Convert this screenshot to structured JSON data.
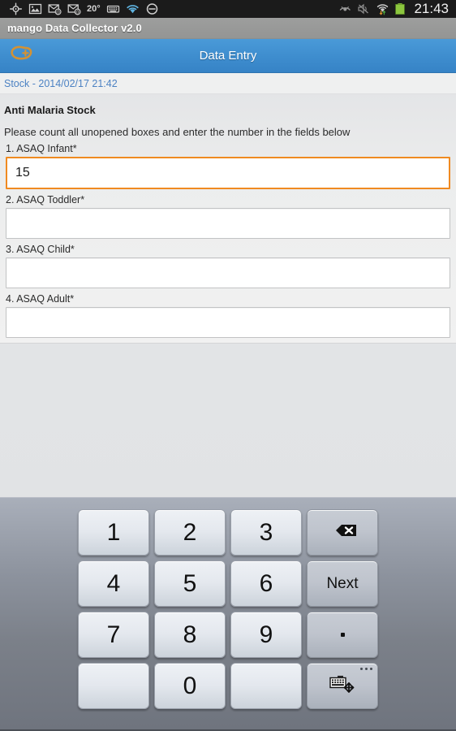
{
  "status_bar": {
    "left_icons": [
      {
        "name": "gps-location-icon",
        "glyph": "gps"
      },
      {
        "name": "image-gallery-icon",
        "glyph": "image"
      },
      {
        "name": "email-at-icon-1",
        "glyph": "email"
      },
      {
        "name": "email-at-icon-2",
        "glyph": "email"
      },
      {
        "name": "keyboard-icon",
        "glyph": "keyboard"
      },
      {
        "name": "wifi-icon",
        "glyph": "wifi"
      },
      {
        "name": "do-not-disturb-icon",
        "glyph": "dnd"
      }
    ],
    "temperature": "20°",
    "right_icons": [
      {
        "name": "smart-stay-eye-icon",
        "glyph": "eye"
      },
      {
        "name": "sound-muted-icon",
        "glyph": "mute"
      },
      {
        "name": "wifi-transfer-icon",
        "glyph": "wifi-arrows"
      },
      {
        "name": "battery-icon",
        "glyph": "battery"
      }
    ],
    "clock": "21:43",
    "battery_color": "#8cc63e"
  },
  "app_bar": {
    "title": "mango Data Collector v2.0"
  },
  "action_bar": {
    "logo_name": "mango-logo-icon",
    "logo_color": "#d49233",
    "title": "Data Entry",
    "accent_color": "#3f8ecf"
  },
  "breadcrumb": {
    "text": "Stock - 2014/02/17 21:42",
    "link_color": "#4c82c3"
  },
  "form": {
    "group_title": "Anti Malaria Stock",
    "group_description": "Please count all unopened boxes and enter the number in the fields below",
    "focus_color": "#f08a21",
    "fields": [
      {
        "label": "1. ASAQ Infant*",
        "value": "15",
        "placeholder": "",
        "focused": true
      },
      {
        "label": "2. ASAQ Toddler*",
        "value": "",
        "placeholder": "",
        "focused": false
      },
      {
        "label": "3. ASAQ Child*",
        "value": "",
        "placeholder": "",
        "focused": false
      },
      {
        "label": "4. ASAQ Adult*",
        "value": "",
        "placeholder": "",
        "focused": false
      }
    ]
  },
  "keyboard": {
    "rows": [
      [
        {
          "label": "1",
          "type": "num",
          "name": "key-1"
        },
        {
          "label": "2",
          "type": "num",
          "name": "key-2"
        },
        {
          "label": "3",
          "type": "num",
          "name": "key-3"
        },
        {
          "label": "",
          "type": "icon",
          "icon": "backspace-icon",
          "name": "key-backspace"
        }
      ],
      [
        {
          "label": "4",
          "type": "num",
          "name": "key-4"
        },
        {
          "label": "5",
          "type": "num",
          "name": "key-5"
        },
        {
          "label": "6",
          "type": "num",
          "name": "key-6"
        },
        {
          "label": "Next",
          "type": "fn",
          "name": "key-next"
        }
      ],
      [
        {
          "label": "7",
          "type": "num",
          "name": "key-7"
        },
        {
          "label": "8",
          "type": "num",
          "name": "key-8"
        },
        {
          "label": "9",
          "type": "num",
          "name": "key-9"
        },
        {
          "label": ".",
          "type": "icon",
          "icon": "period-dot-icon",
          "name": "key-period"
        }
      ],
      [
        {
          "label": "",
          "type": "blank",
          "name": "key-blank-left"
        },
        {
          "label": "0",
          "type": "num",
          "name": "key-0"
        },
        {
          "label": "",
          "type": "blank",
          "name": "key-blank-right"
        },
        {
          "label": "",
          "type": "icon",
          "icon": "keyboard-switch-icon",
          "name": "key-keyboard-options"
        }
      ]
    ]
  }
}
